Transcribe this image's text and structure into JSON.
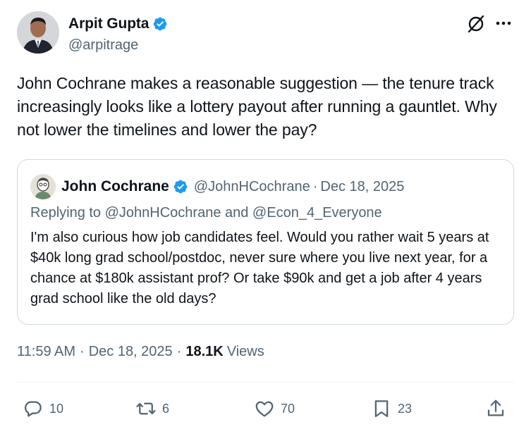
{
  "author": {
    "display_name": "Arpit Gupta",
    "handle": "@arpitrage"
  },
  "tweet": {
    "text": "John Cochrane makes a reasonable suggestion — the tenure track increasingly looks like a lottery payout after running a gauntlet. Why not lower the timelines and lower the pay?"
  },
  "quote": {
    "display_name": "John Cochrane",
    "handle": "@JohnHCochrane",
    "separator": "·",
    "date": "Dec 18, 2025",
    "replying_to": "Replying to @JohnHCochrane and @Econ_4_Everyone",
    "text": "I'm also curious how job candidates feel. Would you rather wait 5 years at $40k long grad school/postdoc, never sure where you live next year, for a chance at $180k assistant prof? Or take $90k and get a job after 4 years grad school like the old days?"
  },
  "meta": {
    "time": "11:59 AM",
    "separator": "·",
    "date": "Dec 18, 2025",
    "views_count": "18.1K",
    "views_label": "Views"
  },
  "actions": {
    "replies": "10",
    "reposts": "6",
    "likes": "70",
    "bookmarks": "23"
  },
  "icons": {
    "verified": "verified-badge-icon",
    "grok": "grok-icon",
    "more": "more-icon",
    "reply": "reply-icon",
    "retweet": "retweet-icon",
    "like": "heart-icon",
    "bookmark": "bookmark-icon",
    "share": "share-icon"
  },
  "colors": {
    "verified_blue": "#1d9bf0",
    "text_primary": "#0f1419",
    "text_secondary": "#536471",
    "border": "#cfd9de"
  }
}
